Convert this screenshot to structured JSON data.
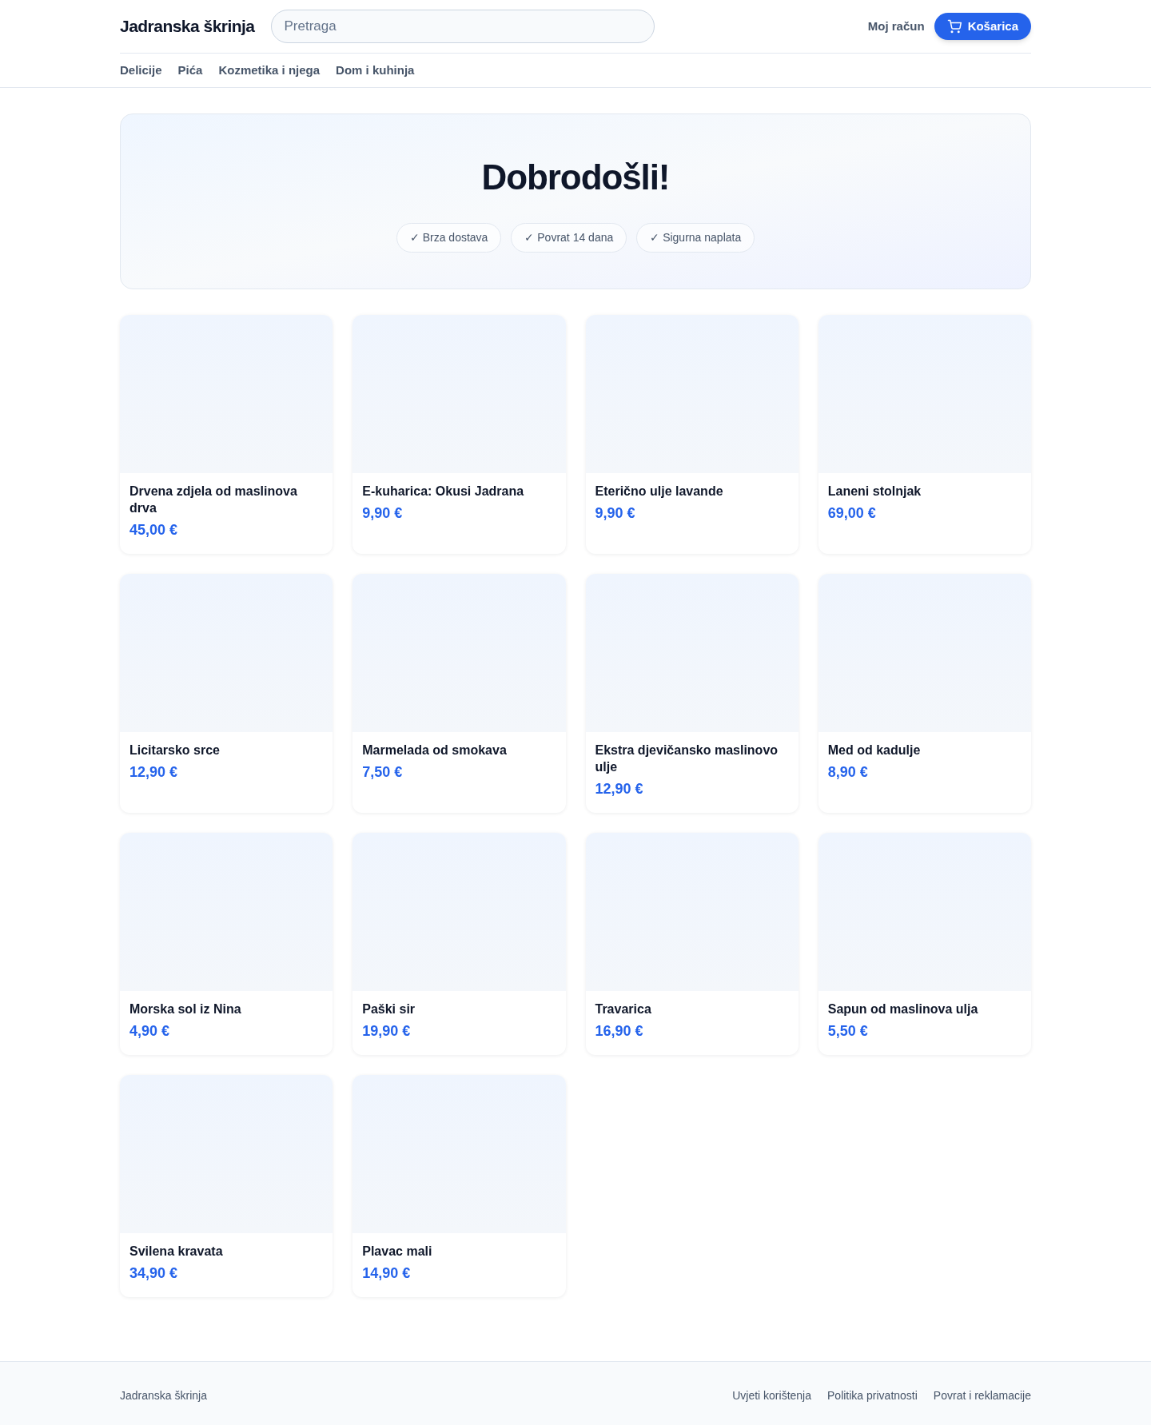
{
  "header": {
    "brand": "Jadranska škrinja",
    "search": {
      "placeholder": "Pretraga"
    },
    "account": "Moj račun",
    "cart": "Košarica"
  },
  "nav": [
    "Delicije",
    "Pića",
    "Kozmetika i njega",
    "Dom i kuhinja"
  ],
  "hero": {
    "title": "Dobrodošli!",
    "badges": [
      "✓ Brza dostava",
      "✓ Povrat 14 dana",
      "✓ Sigurna naplata"
    ]
  },
  "products": [
    {
      "name": "Drvena zdjela od maslinova drva",
      "price": "45,00 €"
    },
    {
      "name": "E-kuharica: Okusi Jadrana",
      "price": "9,90 €"
    },
    {
      "name": "Eterično ulje lavande",
      "price": "9,90 €"
    },
    {
      "name": "Laneni stolnjak",
      "price": "69,00 €"
    },
    {
      "name": "Licitarsko srce",
      "price": "12,90 €"
    },
    {
      "name": "Marmelada od smokava",
      "price": "7,50 €"
    },
    {
      "name": "Ekstra djevičansko maslinovo ulje",
      "price": "12,90 €"
    },
    {
      "name": "Med od kadulje",
      "price": "8,90 €"
    },
    {
      "name": "Morska sol iz Nina",
      "price": "4,90 €"
    },
    {
      "name": "Paški sir",
      "price": "19,90 €"
    },
    {
      "name": "Travarica",
      "price": "16,90 €"
    },
    {
      "name": "Sapun od maslinova ulja",
      "price": "5,50 €"
    },
    {
      "name": "Svilena kravata",
      "price": "34,90 €"
    },
    {
      "name": "Plavac mali",
      "price": "14,90 €"
    }
  ],
  "footer": {
    "brand": "Jadranska škrinja",
    "links": [
      "Uvjeti korištenja",
      "Politika privatnosti",
      "Povrat i reklamacije"
    ]
  }
}
